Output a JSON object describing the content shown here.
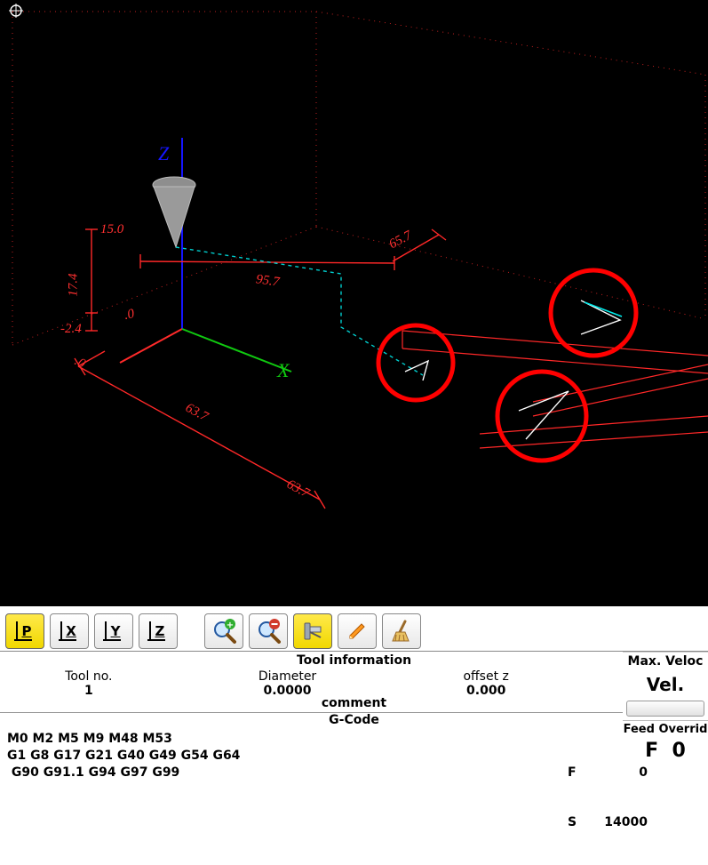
{
  "viewport": {
    "axis_labels": {
      "z": "Z",
      "x": "X"
    },
    "dimension_labels": {
      "left_top": "15.0",
      "left_mid": "17.4",
      "left_bot1": "-2.4",
      "left_bot2": ".0",
      "top_far": "65.7",
      "mid_back": "95.7",
      "bottom_left": ".0",
      "bottom_mid": "63.7",
      "bottom_label": "63.7"
    }
  },
  "toolbar": {
    "p_button": "P",
    "x_button": "X",
    "y_button": "Y",
    "z_button": "Z"
  },
  "tool_info": {
    "title": "Tool information",
    "tool_no_label": "Tool no.",
    "tool_no_value": "1",
    "diameter_label": "Diameter",
    "diameter_value": "0.0000",
    "offset_z_label": "offset z",
    "offset_z_value": "0.000",
    "comment_label": "comment"
  },
  "right_panel": {
    "max_veloc": "Max. Veloc",
    "vel_label": "Vel.",
    "feed_override_label": "Feed Overrid",
    "f_label": "F",
    "f_value": "0"
  },
  "gcode": {
    "title": "G-Code",
    "lines": [
      "M0 M2 M5 M9 M48 M53",
      "G1 G8 G17 G21 G40 G49 G54 G64",
      " G90 G91.1 G94 G97 G99"
    ],
    "status_f_label": "F",
    "status_f_value": "0",
    "status_s_label": "S",
    "status_s_value": "14000"
  }
}
